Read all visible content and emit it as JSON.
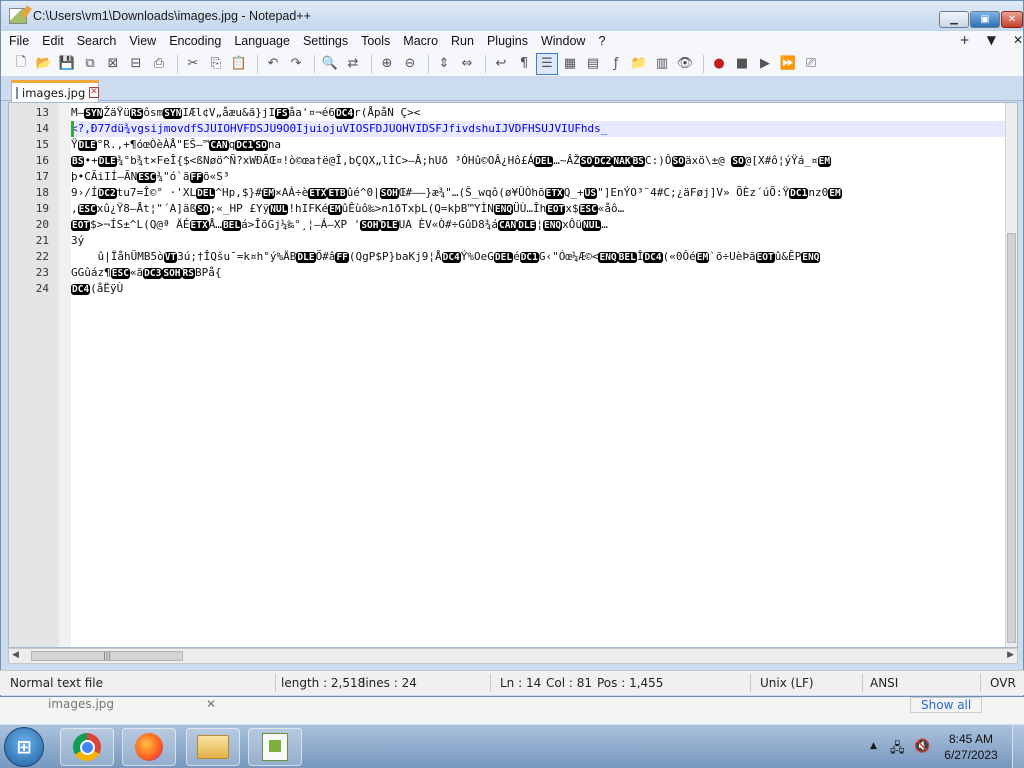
{
  "window": {
    "title": "C:\\Users\\vm1\\Downloads\\images.jpg - Notepad++",
    "minimize_label": "▭",
    "maximize_label": "▣",
    "close_label": "✕"
  },
  "menu": {
    "items": [
      "File",
      "Edit",
      "Search",
      "View",
      "Encoding",
      "Language",
      "Settings",
      "Tools",
      "Macro",
      "Run",
      "Plugins",
      "Window",
      "?"
    ],
    "right_plus": "+",
    "right_down": "▼",
    "right_close": "✕"
  },
  "toolbar": {
    "icons": [
      "new-file-icon",
      "open-file-icon",
      "save-icon",
      "save-all-icon",
      "close-icon",
      "close-all-icon",
      "print-icon",
      "cut-icon",
      "copy-icon",
      "paste-icon",
      "undo-icon",
      "redo-icon",
      "find-icon",
      "replace-icon",
      "zoom-in-icon",
      "zoom-out-icon",
      "sync-vertical-icon",
      "sync-horizontal-icon",
      "word-wrap-icon",
      "show-all-chars-icon",
      "indent-guide-icon",
      "user-language-icon",
      "doc-map-icon",
      "function-list-icon",
      "folder-as-workspace-icon",
      "doc-switcher-icon",
      "monitoring-icon",
      "record-macro-icon",
      "stop-macro-icon",
      "play-macro-icon",
      "run-macro-multiple-icon",
      "save-macro-icon"
    ]
  },
  "tab": {
    "name": "images.jpg",
    "close_label": "✕"
  },
  "editor": {
    "lines": [
      {
        "num": "13",
        "segments": [
          [
            "t",
            "M—"
          ],
          [
            "c",
            "SYN"
          ],
          [
            "t",
            "ŽäŸü"
          ],
          [
            "c",
            "RS"
          ],
          [
            "t",
            "ôsm"
          ],
          [
            "c",
            "SYN"
          ],
          [
            "t",
            "IÆl¢V„åæu&ã}jI"
          ],
          [
            "c",
            "FS"
          ],
          [
            "t",
            "åa'¤¬é6"
          ],
          [
            "c",
            "DC4"
          ],
          [
            "t",
            "r(ÅpåN Ç><"
          ]
        ]
      },
      {
        "num": "14",
        "segments": [
          [
            "h",
            "<?,Ð77dü¾vgsijmovdfSJUIOHVFDSJU9O0IjuiojuVIOSFDJUOHVIDSFJfivdshuIJVDFHSUJVIUFhds_"
          ]
        ]
      },
      {
        "num": "15",
        "segments": [
          [
            "t",
            "Ÿ"
          ],
          [
            "c",
            "DLE"
          ],
          [
            "t",
            "°R.,+¶óœÒèÀÅ\"EŠ—™"
          ],
          [
            "c",
            "CAN"
          ],
          [
            "t",
            "q"
          ],
          [
            "c",
            "DC1"
          ],
          [
            "c",
            "SO"
          ],
          [
            "t",
            "na"
          ]
        ]
      },
      {
        "num": "16",
        "segments": [
          [
            "c",
            "BS"
          ],
          [
            "t",
            "•+"
          ],
          [
            "c",
            "DLE"
          ],
          [
            "t",
            "¾°b¾t×FeÎ{$<ßNøö^Ñ?xWÐÃŒ¤!ò©œa†ë@Î,bÇQX„lÌC>—Â;hUð ³ÓHû©OÂ¿Hô£Á"
          ],
          [
            "c",
            "DEL"
          ],
          [
            "t",
            "…~ÂŽ"
          ],
          [
            "c",
            "SO"
          ],
          [
            "c",
            "DC2"
          ],
          [
            "c",
            "NAK"
          ],
          [
            "c",
            "BS"
          ],
          [
            "t",
            "C:)Ô"
          ],
          [
            "c",
            "SO"
          ],
          [
            "t",
            "äxö\\±@ "
          ],
          [
            "c",
            "SO"
          ],
          [
            "t",
            "@[X#ô¦ýŸá_¤"
          ],
          [
            "c",
            "EM"
          ]
        ]
      },
      {
        "num": "17",
        "segments": [
          [
            "t",
            "þ•CÃiIÍ—ÃN"
          ],
          [
            "c",
            "ESC"
          ],
          [
            "t",
            "¾\"ó`ã"
          ],
          [
            "c",
            "FF"
          ],
          [
            "t",
            "õ«S³"
          ]
        ]
      },
      {
        "num": "18",
        "segments": [
          [
            "t",
            "9›/Í"
          ],
          [
            "c",
            "DC2"
          ],
          [
            "t",
            "tu7=Î©° ·'XL"
          ],
          [
            "c",
            "DEL"
          ],
          [
            "t",
            "^Hp,$}#"
          ],
          [
            "c",
            "EM"
          ],
          [
            "t",
            "×AÀ÷è"
          ],
          [
            "c",
            "ETX"
          ],
          [
            "c",
            "ETB"
          ],
          [
            "t",
            "ûé^0|"
          ],
          [
            "c",
            "SOH"
          ],
          [
            "t",
            "Œ#——}æ¾\"…(Š_wqô(ø¥ÛÒhõ"
          ],
          [
            "c",
            "ETX"
          ],
          [
            "t",
            "Q_+"
          ],
          [
            "c",
            "US"
          ],
          [
            "t",
            "\"]EnÝO³¨4#C;¿äFøj]V» ÕÈz´úÕ:Ÿ"
          ],
          [
            "c",
            "DC1"
          ],
          [
            "t",
            "nz0"
          ],
          [
            "c",
            "EM"
          ]
        ]
      },
      {
        "num": "19",
        "segments": [
          [
            "t",
            ","
          ],
          [
            "c",
            "ESC"
          ],
          [
            "t",
            "xû¿Ÿ8—Åt¦\"´A]äß"
          ],
          [
            "c",
            "SO"
          ],
          [
            "t",
            ";«_HP £Yÿ"
          ],
          [
            "c",
            "NUL"
          ],
          [
            "t",
            "!hIFKé"
          ],
          [
            "c",
            "EM"
          ],
          [
            "t",
            "ûÊùô‰>n1ðTxþL(Q=kþB™YÌN"
          ],
          [
            "c",
            "ENQ"
          ],
          [
            "t",
            "ÜÙ…Îh"
          ],
          [
            "c",
            "EOT"
          ],
          [
            "t",
            "x$"
          ],
          [
            "c",
            "ESC"
          ],
          [
            "t",
            "«åô…"
          ]
        ]
      },
      {
        "num": "20",
        "segments": [
          [
            "c",
            "EOT"
          ],
          [
            "t",
            "$>¬ÍS±^L(Q@ª ÄÉ"
          ],
          [
            "c",
            "ETX"
          ],
          [
            "t",
            "Å…"
          ],
          [
            "c",
            "BEL"
          ],
          [
            "t",
            "á>ÎõGj¼‰°¸¦—Á—XP '"
          ],
          [
            "c",
            "SOH"
          ],
          [
            "c",
            "DLE"
          ],
          [
            "t",
            "UA ÈV«Ò#÷GûD8¾á"
          ],
          [
            "c",
            "CAN"
          ],
          [
            "c",
            "DLE"
          ],
          [
            "t",
            "¦"
          ],
          [
            "c",
            "ENQ"
          ],
          [
            "t",
            "xÔü"
          ],
          [
            "c",
            "NUL"
          ],
          [
            "t",
            "…"
          ]
        ]
      },
      {
        "num": "21",
        "segments": [
          [
            "t",
            "3ý"
          ]
        ]
      },
      {
        "num": "22",
        "segments": [
          [
            "t",
            "    û|ÏåhÜMB5ò"
          ],
          [
            "c",
            "VT"
          ],
          [
            "t",
            "3ú;†ÎQšu¯=k¤h°ý%ÄB"
          ],
          [
            "c",
            "DLE"
          ],
          [
            "t",
            "Ö#â"
          ],
          [
            "c",
            "FF"
          ],
          [
            "t",
            "(QgP$P}baKj9¦Å"
          ],
          [
            "c",
            "DC4"
          ],
          [
            "t",
            "Ý%OeG"
          ],
          [
            "c",
            "DEL"
          ],
          [
            "t",
            "é"
          ],
          [
            "c",
            "DC1"
          ],
          [
            "t",
            "G‹\"Óœ¼Æ©<"
          ],
          [
            "c",
            "ENQ"
          ],
          [
            "c",
            "BEL"
          ],
          [
            "t",
            "Î"
          ],
          [
            "c",
            "DC4"
          ],
          [
            "t",
            "(«0Ôé"
          ],
          [
            "c",
            "EM"
          ],
          [
            "t",
            "`õ÷UèÞã"
          ],
          [
            "c",
            "EOT"
          ],
          [
            "t",
            "û&ÊP"
          ],
          [
            "c",
            "ENQ"
          ]
        ]
      },
      {
        "num": "23",
        "segments": [
          [
            "t",
            "GGûáz¶"
          ],
          [
            "c",
            "ESC"
          ],
          [
            "t",
            "«ã"
          ],
          [
            "c",
            "DC3"
          ],
          [
            "c",
            "SOH"
          ],
          [
            "c",
            "RS"
          ],
          [
            "t",
            "BPå{"
          ]
        ]
      },
      {
        "num": "24",
        "segments": [
          [
            "c",
            "DC4"
          ],
          [
            "t",
            "(åËÿÙ"
          ]
        ]
      }
    ]
  },
  "statusbar": {
    "file_type": "Normal text file",
    "length": "length : 2,518",
    "lines": "lines : 24",
    "ln": "Ln : 14",
    "col": "Col : 81",
    "pos": "Pos : 1,455",
    "eol": "Unix (LF)",
    "encoding": "ANSI",
    "mode": "OVR"
  },
  "background_window": {
    "filename": "images.jpg",
    "close_label": "✕",
    "show_all_label": "Show all"
  },
  "taskbar": {
    "start_label": "⊞",
    "clock_time": "8:45 AM",
    "clock_date": "6/27/2023",
    "tray_arrow": "▲"
  },
  "colors": {
    "accent_tab": "#f2a73b",
    "control_char_bg": "#000000",
    "current_line_bg": "#e8e8ff",
    "line14_text": "#0000ff"
  }
}
